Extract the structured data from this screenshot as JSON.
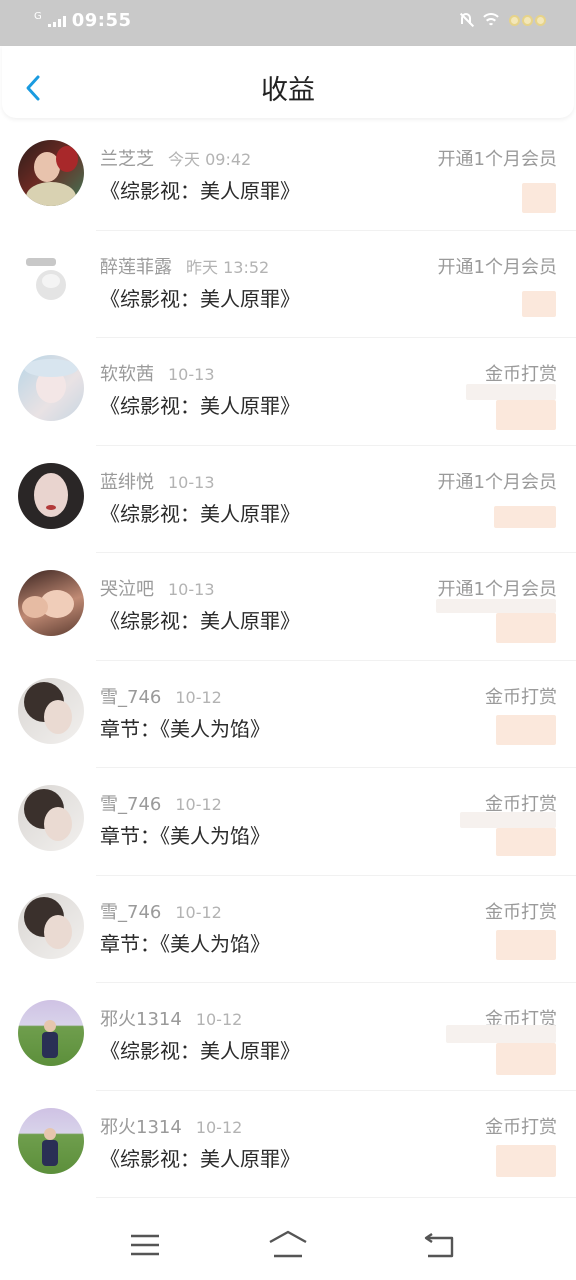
{
  "status_bar": {
    "time": "09:55",
    "network": "G",
    "icons": [
      "signal-icon",
      "mute-bell-icon",
      "wifi-icon",
      "flower-stickers-icon"
    ]
  },
  "header": {
    "title": "收益",
    "back_icon": "chevron-left-icon",
    "accent_color": "#1a9be0"
  },
  "earnings": [
    {
      "name": "兰芝芝",
      "time": "今天 09:42",
      "book": "《综影视：美人原罪》",
      "type": "开通1个月会员",
      "avatar": "avatar-girl-red"
    },
    {
      "name": "醉莲菲露",
      "time": "昨天 13:52",
      "book": "《综影视：美人原罪》",
      "type": "开通1个月会员",
      "avatar": "avatar-cartoon-sheep"
    },
    {
      "name": "软软茜",
      "time": "10-13",
      "book": "《综影视：美人原罪》",
      "type": "金币打赏",
      "avatar": "avatar-pale-girl"
    },
    {
      "name": "蓝绯悦",
      "time": "10-13",
      "book": "《综影视：美人原罪》",
      "type": "开通1个月会员",
      "avatar": "avatar-dark-hair-girl"
    },
    {
      "name": "哭泣吧",
      "time": "10-13",
      "book": "《综影视：美人原罪》",
      "type": "开通1个月会员",
      "avatar": "avatar-hand-face-girl"
    },
    {
      "name": "雪_746",
      "time": "10-12",
      "book": "章节：《美人为馅》",
      "type": "金币打赏",
      "avatar": "avatar-bun-hair-girl"
    },
    {
      "name": "雪_746",
      "time": "10-12",
      "book": "章节：《美人为馅》",
      "type": "金币打赏",
      "avatar": "avatar-bun-hair-girl"
    },
    {
      "name": "雪_746",
      "time": "10-12",
      "book": "章节：《美人为馅》",
      "type": "金币打赏",
      "avatar": "avatar-bun-hair-girl"
    },
    {
      "name": "邪火1314",
      "time": "10-12",
      "book": "《综影视：美人原罪》",
      "type": "金币打赏",
      "avatar": "avatar-boy-grass-field"
    },
    {
      "name": "邪火1314",
      "time": "10-12",
      "book": "《综影视：美人原罪》",
      "type": "金币打赏",
      "avatar": "avatar-boy-grass-field"
    }
  ],
  "nav_bar": {
    "icons": [
      "menu-icon",
      "home-icon",
      "back-nav-icon"
    ]
  }
}
